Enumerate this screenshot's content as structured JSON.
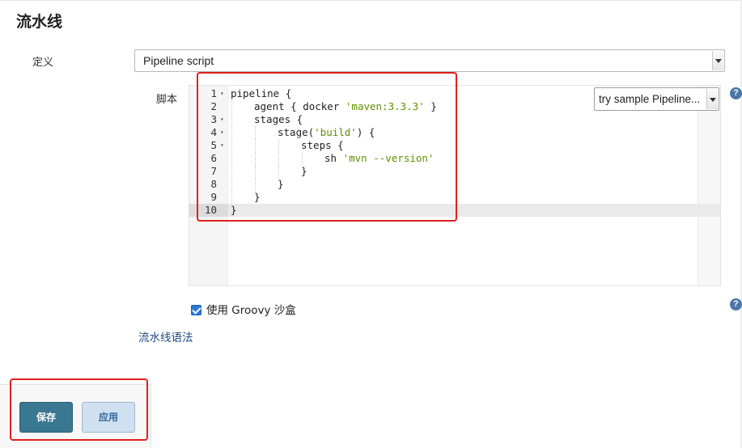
{
  "section_title": "流水线",
  "definition": {
    "label": "定义",
    "selected": "Pipeline script"
  },
  "script": {
    "label": "脚本",
    "sample_select": "try sample Pipeline...",
    "active_line": 10,
    "lines": [
      {
        "n": "1",
        "fold": "▾",
        "indent": 0,
        "parts": [
          {
            "t": "pipeline {",
            "s": false
          }
        ]
      },
      {
        "n": "2",
        "fold": "",
        "indent": 1,
        "parts": [
          {
            "t": "agent { docker ",
            "s": false
          },
          {
            "t": "'maven:3.3.3'",
            "s": true
          },
          {
            "t": " }",
            "s": false
          }
        ]
      },
      {
        "n": "3",
        "fold": "▾",
        "indent": 1,
        "parts": [
          {
            "t": "stages {",
            "s": false
          }
        ]
      },
      {
        "n": "4",
        "fold": "▾",
        "indent": 2,
        "parts": [
          {
            "t": "stage(",
            "s": false
          },
          {
            "t": "'build'",
            "s": true
          },
          {
            "t": ") {",
            "s": false
          }
        ]
      },
      {
        "n": "5",
        "fold": "▾",
        "indent": 3,
        "parts": [
          {
            "t": "steps {",
            "s": false
          }
        ]
      },
      {
        "n": "6",
        "fold": "",
        "indent": 4,
        "parts": [
          {
            "t": "sh ",
            "s": false
          },
          {
            "t": "'mvn --version'",
            "s": true
          }
        ]
      },
      {
        "n": "7",
        "fold": "",
        "indent": 3,
        "parts": [
          {
            "t": "}",
            "s": false
          }
        ]
      },
      {
        "n": "8",
        "fold": "",
        "indent": 2,
        "parts": [
          {
            "t": "}",
            "s": false
          }
        ]
      },
      {
        "n": "9",
        "fold": "",
        "indent": 1,
        "parts": [
          {
            "t": "}",
            "s": false
          }
        ]
      },
      {
        "n": "10",
        "fold": "",
        "indent": 0,
        "parts": [
          {
            "t": "}",
            "s": false
          }
        ]
      }
    ]
  },
  "groovy_sandbox": {
    "label": "使用 Groovy 沙盒",
    "checked": true
  },
  "pipeline_syntax_link": "流水线语法",
  "help_icon": "?",
  "buttons": {
    "save": "保存",
    "apply": "应用"
  },
  "colors": {
    "accent": "#3a7791",
    "link": "#204a87",
    "string": "#5f8f00",
    "highlight": "#e0201f"
  }
}
